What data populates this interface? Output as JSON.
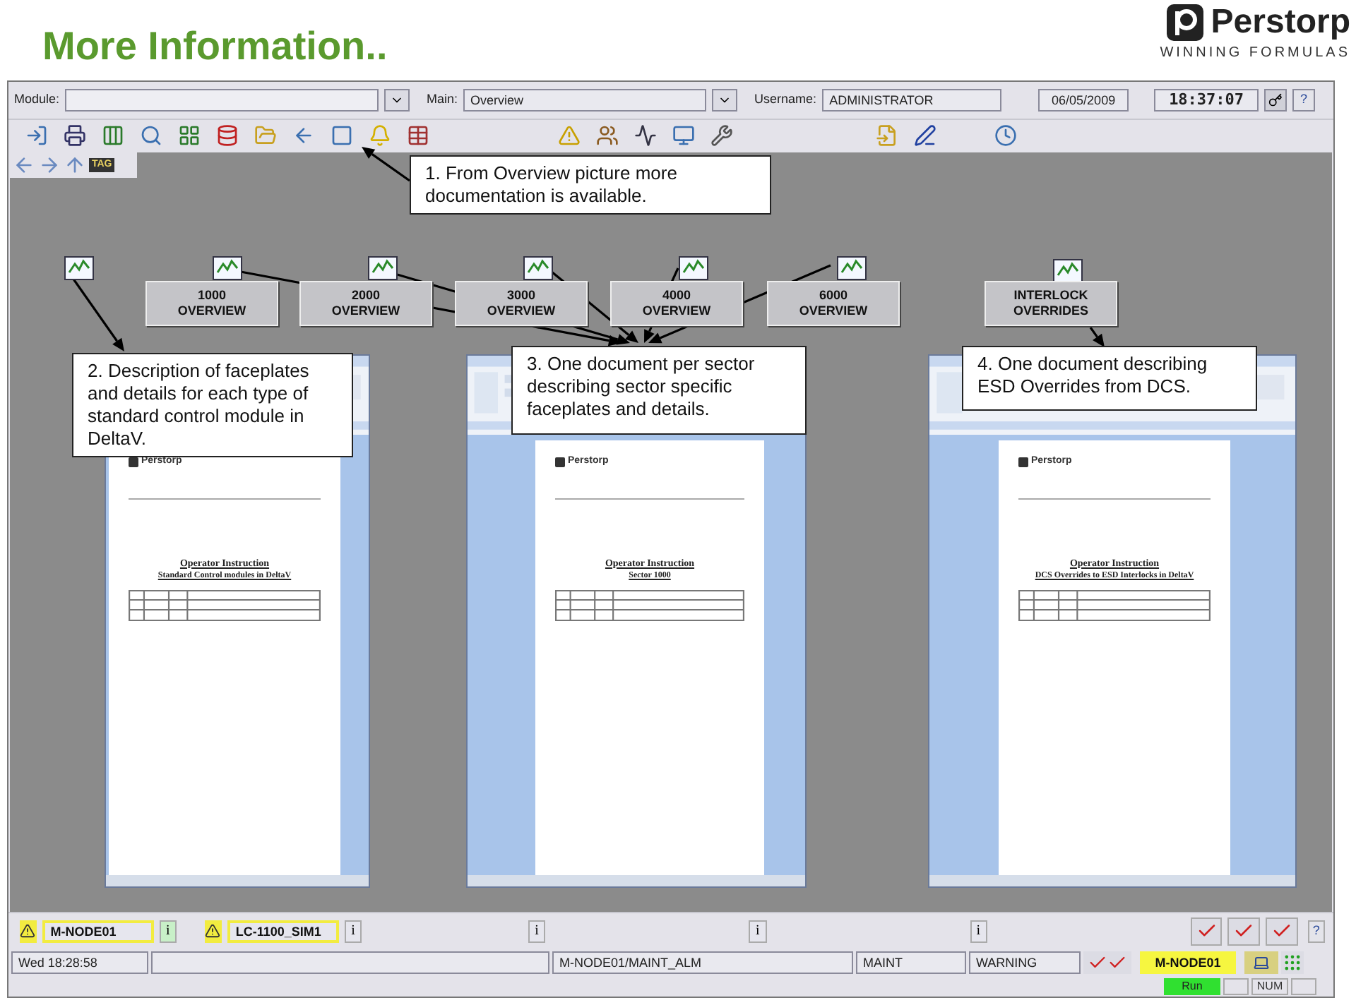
{
  "header": {
    "title": "More Information..",
    "logo": {
      "name": "Perstorp",
      "tagline": "WINNING FORMULAS"
    }
  },
  "top_bar": {
    "module": {
      "label": "Module:"
    },
    "main": {
      "label": "Main:",
      "value": "Overview"
    },
    "username": {
      "label": "Username:",
      "value": "ADMINISTRATOR"
    },
    "date": "06/05/2009",
    "time": "18:37:07",
    "help": "?"
  },
  "nav": {
    "tag": "TAG"
  },
  "overview_buttons": [
    {
      "line1": "1000",
      "line2": "OVERVIEW"
    },
    {
      "line1": "2000",
      "line2": "OVERVIEW"
    },
    {
      "line1": "3000",
      "line2": "OVERVIEW"
    },
    {
      "line1": "4000",
      "line2": "OVERVIEW"
    },
    {
      "line1": "6000",
      "line2": "OVERVIEW"
    },
    {
      "line1": "INTERLOCK",
      "line2": "OVERRIDES"
    }
  ],
  "documents": [
    {
      "logo": "Perstorp",
      "title": "Operator Instruction",
      "subtitle": "Standard Control modules in DeltaV"
    },
    {
      "logo": "Perstorp",
      "title": "Operator Instruction",
      "subtitle": "Sector 1000"
    },
    {
      "logo": "Perstorp",
      "title": "Operator Instruction",
      "subtitle": "DCS Overrides to ESD Interlocks in DeltaV"
    }
  ],
  "callouts": [
    {
      "text": "1. From Overview picture more documentation is available."
    },
    {
      "text": "2. Description of faceplates and details for each type of standard control module in DeltaV."
    },
    {
      "text": "3. One document per sector describing sector specific faceplates and details."
    },
    {
      "text": "4. One document describing ESD Overrides from DCS."
    }
  ],
  "alarm_bar": {
    "alarms": [
      {
        "name": "M-NODE01",
        "info": "i",
        "highlighted": true
      },
      {
        "name": "LC-1100_SIM1",
        "info": "i",
        "highlighted": false
      }
    ],
    "info_buttons": [
      "i",
      "i",
      "i"
    ],
    "help": "?"
  },
  "status_bar": {
    "time": "Wed 18:28:58",
    "alarm": "M-NODE01/MAINT_ALM",
    "category": "MAINT",
    "priority": "WARNING",
    "node": "M-NODE01"
  },
  "footer": {
    "mode": "Run",
    "num": "NUM"
  }
}
